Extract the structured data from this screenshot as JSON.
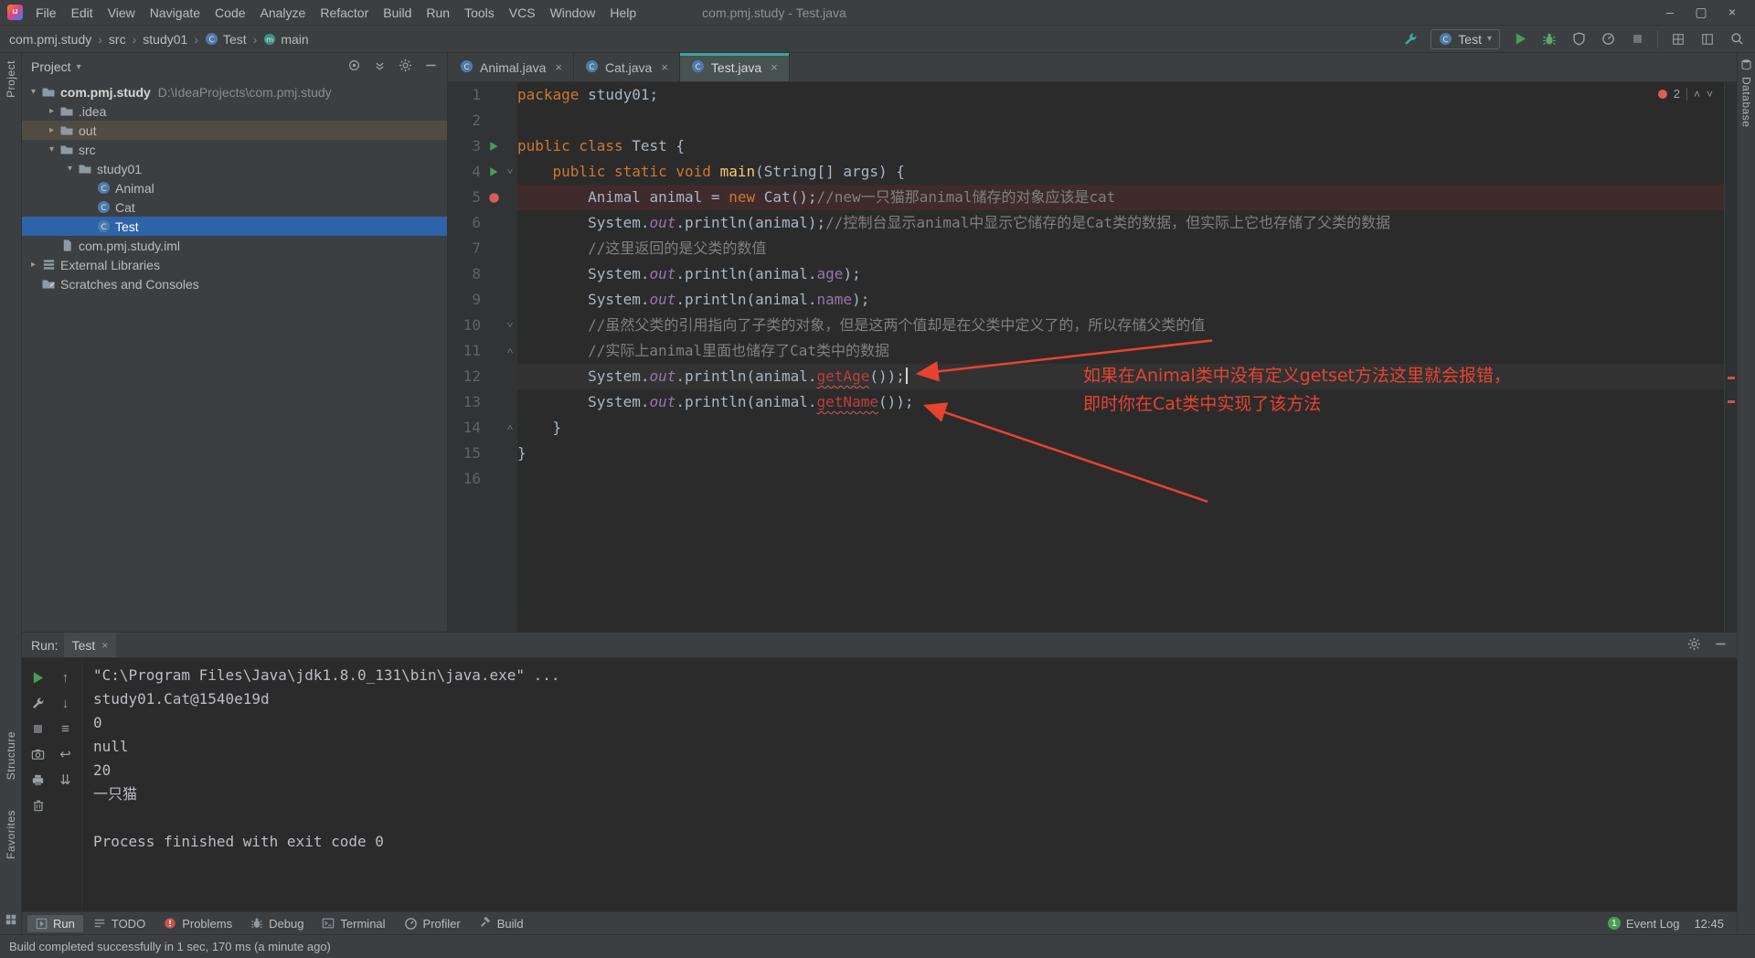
{
  "colors": {
    "accent_teal": "#3aa49b",
    "selection_blue": "#2d63a8",
    "error_red": "#bc3f3c",
    "annotation_red": "#e8432f",
    "run_green": "#499c54",
    "breakpoint_red": "#db5c5c"
  },
  "title_bar": {
    "menus": [
      "File",
      "Edit",
      "View",
      "Navigate",
      "Code",
      "Analyze",
      "Refactor",
      "Build",
      "Run",
      "Tools",
      "VCS",
      "Window",
      "Help"
    ],
    "title": "com.pmj.study - Test.java"
  },
  "navbar": {
    "breadcrumbs": [
      {
        "label": "com.pmj.study"
      },
      {
        "label": "src"
      },
      {
        "label": "study01"
      },
      {
        "label": "Test",
        "icon": "class"
      },
      {
        "label": "main",
        "icon": "method"
      }
    ],
    "run_config": "Test"
  },
  "project_panel": {
    "title": "Project",
    "tree": [
      {
        "label": "com.pmj.study",
        "hint": "D:\\IdeaProjects\\com.pmj.study",
        "icon": "folder",
        "level": 0,
        "arrow": "down",
        "bold": true
      },
      {
        "label": ".idea",
        "icon": "folder",
        "level": 1,
        "arrow": "right"
      },
      {
        "label": "out",
        "icon": "folder",
        "level": 1,
        "arrow": "right",
        "state": "hover"
      },
      {
        "label": "src",
        "icon": "folder",
        "level": 1,
        "arrow": "down"
      },
      {
        "label": "study01",
        "icon": "folder",
        "level": 2,
        "arrow": "down"
      },
      {
        "label": "Animal",
        "icon": "class",
        "level": 3
      },
      {
        "label": "Cat",
        "icon": "class",
        "level": 3
      },
      {
        "label": "Test",
        "icon": "class",
        "level": 3,
        "state": "selected"
      },
      {
        "label": "com.pmj.study.iml",
        "icon": "file",
        "level": 1
      },
      {
        "label": "External Libraries",
        "icon": "lib",
        "level": 0,
        "arrow": "right"
      },
      {
        "label": "Scratches and Consoles",
        "icon": "scratch",
        "level": 0
      }
    ]
  },
  "editor": {
    "tabs": [
      {
        "label": "Animal.java",
        "active": false
      },
      {
        "label": "Cat.java",
        "active": false
      },
      {
        "label": "Test.java",
        "active": true
      }
    ],
    "error_count": "2",
    "lines": [
      {
        "n": 1,
        "seg": [
          {
            "t": "package ",
            "c": "k"
          },
          {
            "t": "study01;"
          }
        ]
      },
      {
        "n": 2,
        "seg": []
      },
      {
        "n": 3,
        "marker": "run",
        "seg": [
          {
            "t": "public class ",
            "c": "k"
          },
          {
            "t": "Test {"
          }
        ]
      },
      {
        "n": 4,
        "marker": "run",
        "fold": "down",
        "seg": [
          {
            "t": "    "
          },
          {
            "t": "public static void ",
            "c": "k"
          },
          {
            "t": "main",
            "c": "m"
          },
          {
            "t": "(String[] args) {"
          }
        ]
      },
      {
        "n": 5,
        "marker": "bp",
        "hl": "bp",
        "seg": [
          {
            "t": "        Animal animal = "
          },
          {
            "t": "new",
            "c": "k"
          },
          {
            "t": " Cat();"
          },
          {
            "t": "//new一只猫那animal储存的对象应该是cat",
            "c": "c"
          }
        ]
      },
      {
        "n": 6,
        "seg": [
          {
            "t": "        System."
          },
          {
            "t": "out",
            "c": "f"
          },
          {
            "t": ".println(animal);"
          },
          {
            "t": "//控制台显示animal中显示它储存的是Cat类的数据，但实际上它也存储了父类的数据",
            "c": "c"
          }
        ]
      },
      {
        "n": 7,
        "seg": [
          {
            "t": "        "
          },
          {
            "t": "//这里返回的是父类的数值",
            "c": "c"
          }
        ]
      },
      {
        "n": 8,
        "seg": [
          {
            "t": "        System."
          },
          {
            "t": "out",
            "c": "f"
          },
          {
            "t": ".println(animal."
          },
          {
            "t": "age",
            "c": "f2"
          },
          {
            "t": ");"
          }
        ]
      },
      {
        "n": 9,
        "seg": [
          {
            "t": "        System."
          },
          {
            "t": "out",
            "c": "f"
          },
          {
            "t": ".println(animal."
          },
          {
            "t": "name",
            "c": "f2"
          },
          {
            "t": ");"
          }
        ]
      },
      {
        "n": 10,
        "fold": "down",
        "seg": [
          {
            "t": "        "
          },
          {
            "t": "//虽然父类的引用指向了子类的对象，但是这两个值却是在父类中定义了的，所以存储父类的值",
            "c": "c"
          }
        ]
      },
      {
        "n": 11,
        "fold": "up",
        "seg": [
          {
            "t": "        "
          },
          {
            "t": "//实际上animal里面也储存了Cat类中的数据",
            "c": "c"
          }
        ]
      },
      {
        "n": 12,
        "hl": "caret",
        "caret": true,
        "seg": [
          {
            "t": "        System."
          },
          {
            "t": "out",
            "c": "f"
          },
          {
            "t": ".println(animal."
          },
          {
            "t": "getAge",
            "c": "e"
          },
          {
            "t": "());"
          }
        ]
      },
      {
        "n": 13,
        "seg": [
          {
            "t": "        System."
          },
          {
            "t": "out",
            "c": "f"
          },
          {
            "t": ".println(animal."
          },
          {
            "t": "getName",
            "c": "e"
          },
          {
            "t": "());"
          }
        ]
      },
      {
        "n": 14,
        "fold": "up",
        "seg": [
          {
            "t": "    }"
          }
        ]
      },
      {
        "n": 15,
        "seg": [
          {
            "t": "}"
          }
        ]
      },
      {
        "n": 16,
        "seg": []
      }
    ]
  },
  "annotation": {
    "line1": "如果在Animal类中没有定义getset方法这里就会报错，",
    "line2": "即时你在Cat类中实现了该方法"
  },
  "run_panel": {
    "label": "Run:",
    "tab": "Test",
    "tools": [
      "rerun",
      "stack-up",
      "settings",
      "stack-down",
      "stop",
      "console-menu",
      "screenshot",
      "soft-wrap",
      "print",
      "scroll-end",
      "clear"
    ],
    "console": [
      "\"C:\\Program Files\\Java\\jdk1.8.0_131\\bin\\java.exe\" ...",
      "study01.Cat@1540e19d",
      "0",
      "null",
      "20",
      "一只猫",
      "",
      "Process finished with exit code 0"
    ]
  },
  "bottom_bar": {
    "items": [
      {
        "label": "Run",
        "icon": "tw-run",
        "active": true
      },
      {
        "label": "TODO",
        "icon": "todo"
      },
      {
        "label": "Problems",
        "icon": "problems"
      },
      {
        "label": "Debug",
        "icon": "bug-gray"
      },
      {
        "label": "Terminal",
        "icon": "terminal"
      },
      {
        "label": "Profiler",
        "icon": "gauge"
      },
      {
        "label": "Build",
        "icon": "hammer"
      }
    ],
    "event_log": "Event Log",
    "event_count": "1",
    "time": "12:45"
  },
  "status_bar": {
    "message": "Build completed successfully in 1 sec, 170 ms (a minute ago)"
  },
  "strips": {
    "left_top": "Project",
    "structure": "Structure",
    "favorites": "Favorites",
    "right": "Database"
  }
}
